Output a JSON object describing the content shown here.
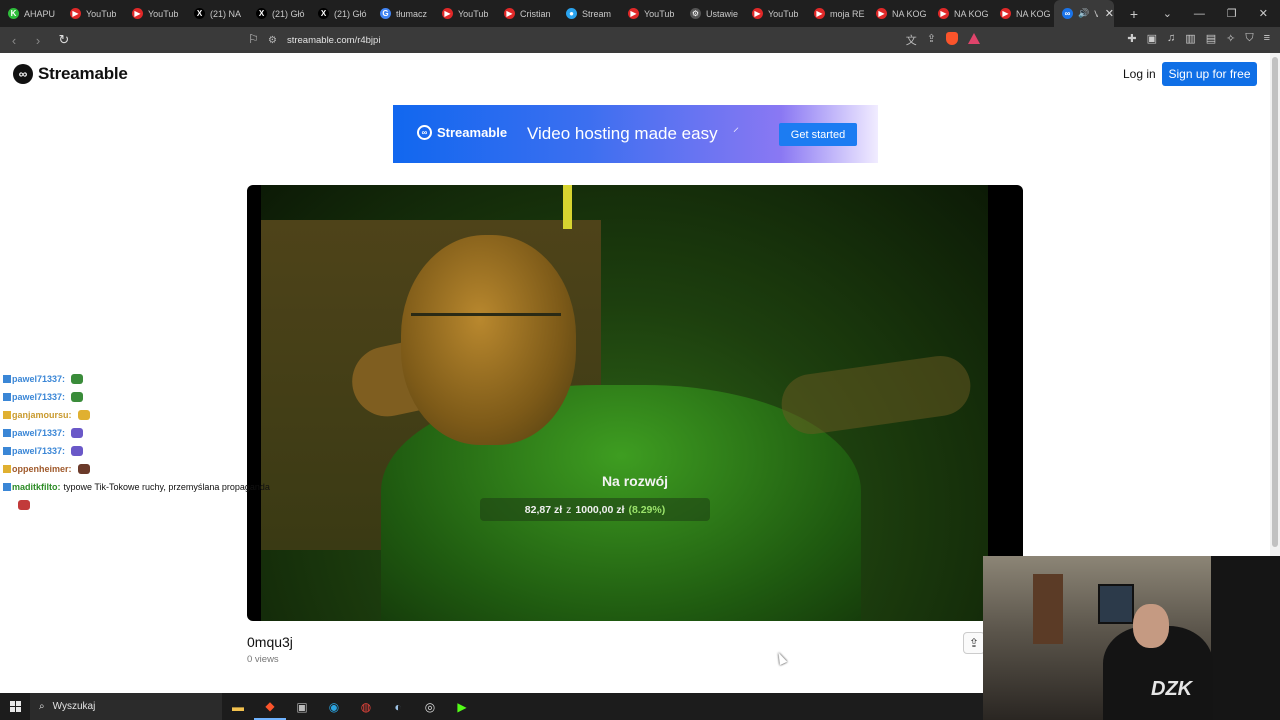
{
  "browser": {
    "tabs": [
      {
        "label": "AHAPU",
        "color": "#2ebd3b",
        "glyph": "K"
      },
      {
        "label": "YouTub",
        "color": "#e02828",
        "glyph": "▶"
      },
      {
        "label": "YouTub",
        "color": "#e02828",
        "glyph": "▶"
      },
      {
        "label": "(21) NA",
        "color": "#000000",
        "glyph": "X"
      },
      {
        "label": "(21) Głó",
        "color": "#000000",
        "glyph": "X"
      },
      {
        "label": "(21) Głó",
        "color": "#000000",
        "glyph": "X"
      },
      {
        "label": "tłumacz",
        "color": "#4285f4",
        "glyph": "G"
      },
      {
        "label": "YouTub",
        "color": "#e02828",
        "glyph": "▶"
      },
      {
        "label": "Cristian",
        "color": "#e02828",
        "glyph": "▶"
      },
      {
        "label": "Stream",
        "color": "#2aa3ee",
        "glyph": "●"
      },
      {
        "label": "YouTub",
        "color": "#e02828",
        "glyph": "▶"
      },
      {
        "label": "Ustawie",
        "color": "#555555",
        "glyph": "⚙"
      },
      {
        "label": "YouTub",
        "color": "#e02828",
        "glyph": "▶"
      },
      {
        "label": "moja RE",
        "color": "#e02828",
        "glyph": "▶"
      },
      {
        "label": "NA KOG",
        "color": "#e02828",
        "glyph": "▶"
      },
      {
        "label": "NA KOG",
        "color": "#e02828",
        "glyph": "▶"
      },
      {
        "label": "NA KOG",
        "color": "#e02828",
        "glyph": "▶"
      }
    ],
    "active_tab": {
      "label": "V",
      "color": "#1a73e8",
      "glyph": "∞"
    },
    "url": "streamable.com/r4bjpi"
  },
  "site": {
    "brand": "Streamable",
    "login": "Log in",
    "signup": "Sign up for free"
  },
  "banner": {
    "brand": "Streamable",
    "tagline": "Video hosting made easy",
    "cta": "Get started"
  },
  "video": {
    "overlay_title": "Na rozwój",
    "overlay_raised": "82,87 zł",
    "overlay_sep": "z",
    "overlay_goal": "1000,00 zł",
    "overlay_pct": "(8.29%)",
    "title": "0mqu3j",
    "views": "0 views"
  },
  "chat": [
    {
      "user": "pawel71337:",
      "msg": "",
      "cls": "",
      "emote": "#3a8c3a"
    },
    {
      "user": "pawel71337:",
      "msg": "",
      "cls": "",
      "emote": "#3a8c3a"
    },
    {
      "user": "ganjamoursu:",
      "msg": "",
      "cls": "gold",
      "emote": "#e0b030"
    },
    {
      "user": "pawel71337:",
      "msg": "",
      "cls": "",
      "emote": "#6a58c8"
    },
    {
      "user": "pawel71337:",
      "msg": "",
      "cls": "",
      "emote": "#6a58c8"
    },
    {
      "user": "oppenheimer:",
      "msg": "",
      "cls": "brown",
      "emote": "#6b3a2a"
    },
    {
      "user": "maditkfilto:",
      "msg": "typowe Tik-Tokowe ruchy, przemyślana propaganda",
      "cls": "green",
      "emote": ""
    },
    {
      "user": "",
      "msg": "",
      "cls": "",
      "emote": "#c23a3a"
    }
  ],
  "taskbar": {
    "search_placeholder": "Wyszukaj"
  }
}
